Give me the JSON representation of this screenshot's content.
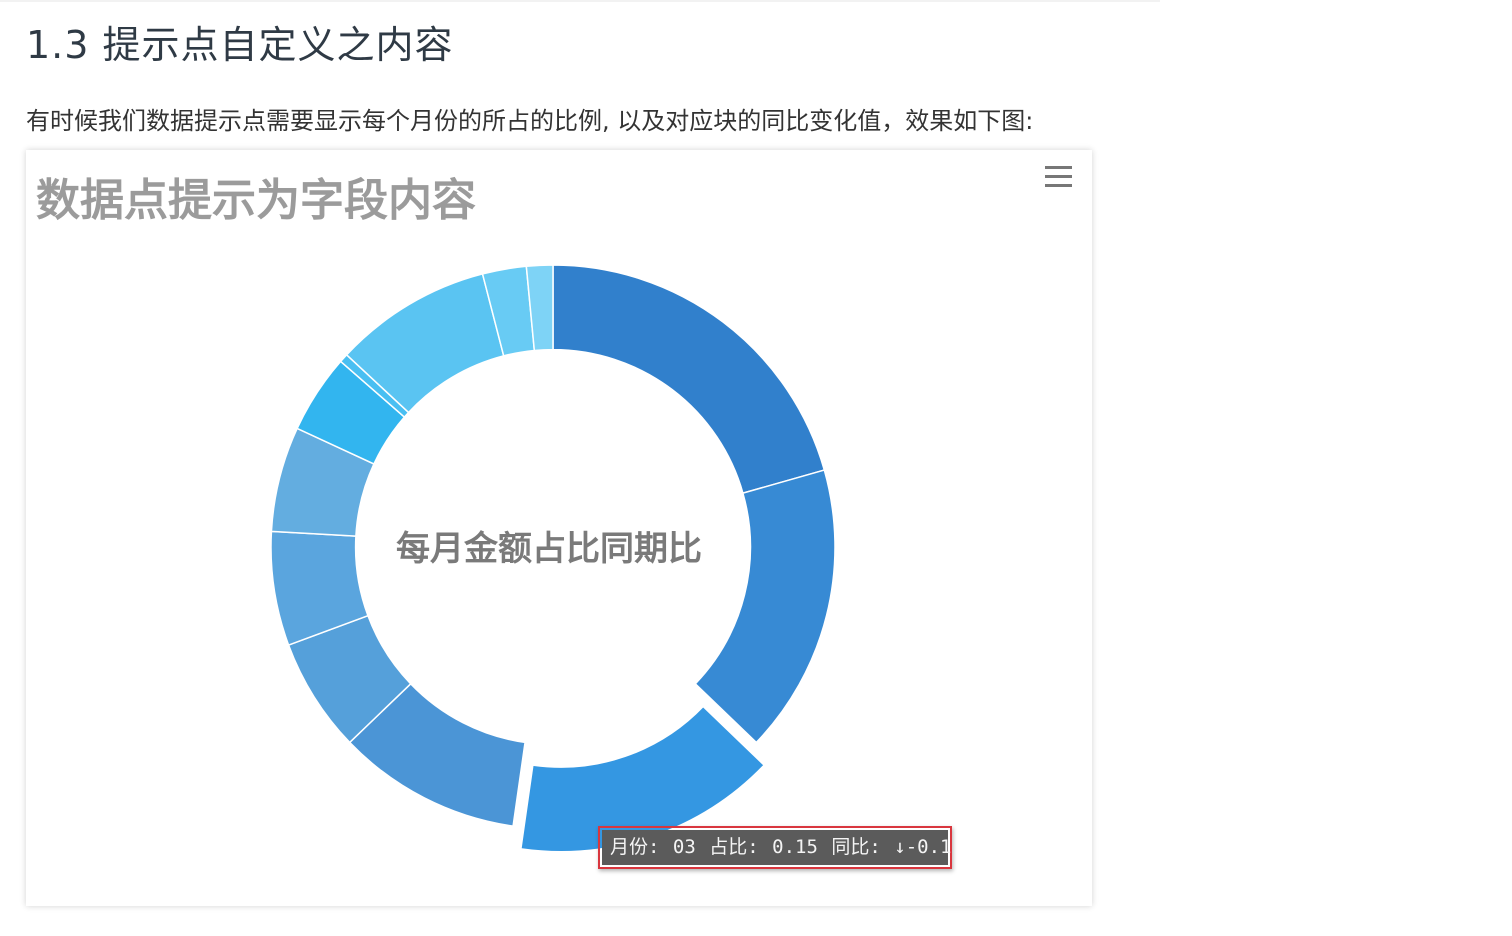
{
  "page": {
    "section_title": "1.3 提示点自定义之内容",
    "intro": "有时候我们数据提示点需要显示每个月份的所占的比例, 以及对应块的同比变化值，效果如下图:"
  },
  "chart": {
    "menu_icon": "hamburger-menu-icon",
    "tooltip": {
      "month_label": "月份:",
      "month_value": "03",
      "ratio_label": "占比:",
      "ratio_value": "0.15",
      "yoy_label": "同比:",
      "yoy_value": "↓-0.1"
    },
    "colors": {
      "title": "#9b9b9b",
      "center_text": "#7a7a7a",
      "highlight_border": "#d9363e",
      "tooltip_bg": "#5b5b5b"
    }
  },
  "chart_data": {
    "type": "pie",
    "title": "数据点提示为字段内容",
    "center_label": "每月金额占比同期比",
    "hole_ratio": 0.7,
    "selected_index": 2,
    "slices": [
      {
        "value": 20.5,
        "color": "#3180cc"
      },
      {
        "value": 16.5,
        "color": "#378ad4"
      },
      {
        "value": 15.0,
        "color": "#3497e2"
      },
      {
        "value": 10.5,
        "color": "#4b95d6"
      },
      {
        "value": 6.5,
        "color": "#55a0da"
      },
      {
        "value": 6.5,
        "color": "#5aa5de"
      },
      {
        "value": 6.0,
        "color": "#63ade0"
      },
      {
        "value": 4.5,
        "color": "#32b5ef"
      },
      {
        "value": 0.5,
        "color": "#49bff2"
      },
      {
        "value": 9.0,
        "color": "#5ac4f2"
      },
      {
        "value": 2.5,
        "color": "#68cbf4"
      },
      {
        "value": 1.5,
        "color": "#7ed3f6"
      }
    ]
  }
}
